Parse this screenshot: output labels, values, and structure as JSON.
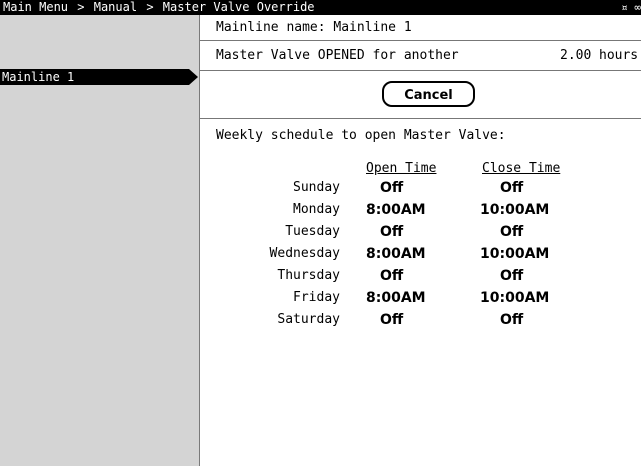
{
  "header": {
    "breadcrumbs": [
      "Main Menu",
      "Manual",
      "Master Valve Override"
    ],
    "separator": ">",
    "status_icons": "¤ ∞"
  },
  "sidebar": {
    "items": [
      {
        "label": "Mainline 1",
        "selected": true
      }
    ]
  },
  "main": {
    "mainline_name": "Mainline name: Mainline 1",
    "status_prefix": "Master Valve OPENED for another",
    "status_value": "2.00",
    "status_unit": "hours",
    "cancel_label": "Cancel",
    "schedule_title": "Weekly schedule to open Master Valve:",
    "open_header": "Open Time",
    "close_header": "Close Time",
    "schedule": [
      {
        "day": "Sunday",
        "open": "Off",
        "close": "Off"
      },
      {
        "day": "Monday",
        "open": "8:00AM",
        "close": "10:00AM"
      },
      {
        "day": "Tuesday",
        "open": "Off",
        "close": "Off"
      },
      {
        "day": "Wednesday",
        "open": "8:00AM",
        "close": "10:00AM"
      },
      {
        "day": "Thursday",
        "open": "Off",
        "close": "Off"
      },
      {
        "day": "Friday",
        "open": "8:00AM",
        "close": "10:00AM"
      },
      {
        "day": "Saturday",
        "open": "Off",
        "close": "Off"
      }
    ]
  },
  "colors": {
    "background": "#ffffff",
    "sidebar": "#d4d4d4",
    "titlebar": "#000000",
    "selected": "#000000"
  }
}
